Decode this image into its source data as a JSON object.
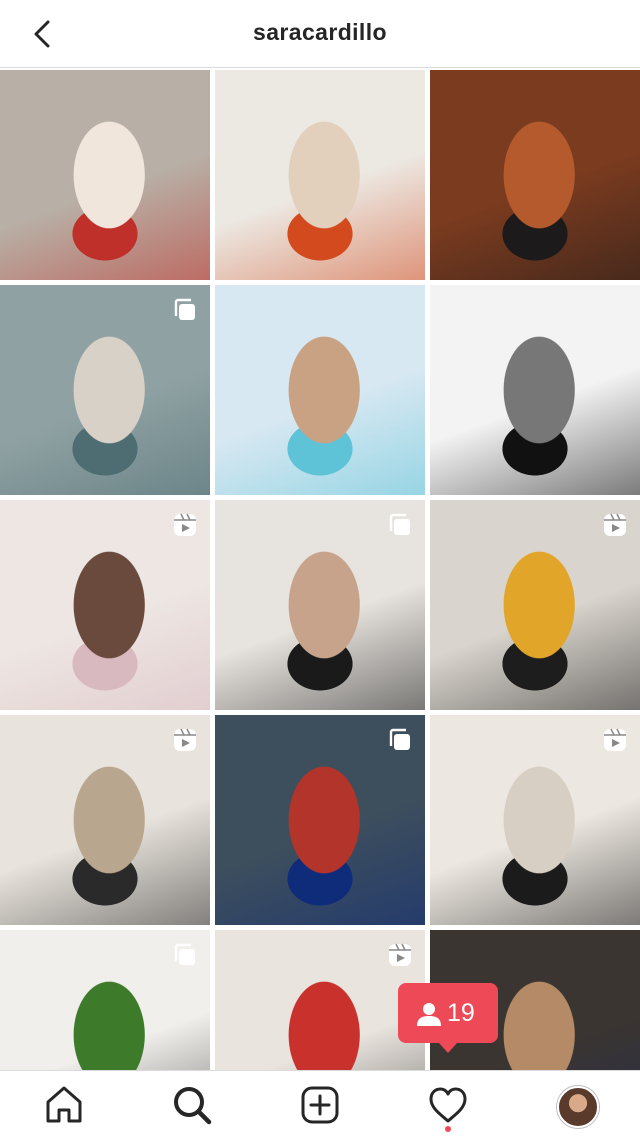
{
  "header": {
    "username": "saracardillo",
    "back_icon": "chevron-left-icon"
  },
  "posts": [
    {
      "id": 1,
      "badge": "none",
      "colors": [
        "#b8b0a6",
        "#c0302a",
        "#f1e6dc"
      ]
    },
    {
      "id": 2,
      "badge": "none",
      "colors": [
        "#ece8e2",
        "#d24a1e",
        "#e2d0bd"
      ]
    },
    {
      "id": 3,
      "badge": "none",
      "colors": [
        "#7a3b1f",
        "#1c1a1a",
        "#b45a2c"
      ]
    },
    {
      "id": 4,
      "badge": "carousel",
      "colors": [
        "#8fa1a3",
        "#4e6d72",
        "#d8d1c7"
      ]
    },
    {
      "id": 5,
      "badge": "none",
      "colors": [
        "#d7e8f2",
        "#5fc3d8",
        "#c9a183"
      ]
    },
    {
      "id": 6,
      "badge": "none",
      "colors": [
        "#f3f3f3",
        "#111111",
        "#777777"
      ]
    },
    {
      "id": 7,
      "badge": "reel",
      "colors": [
        "#ede6e2",
        "#d9b9c0",
        "#6b4a3e"
      ]
    },
    {
      "id": 8,
      "badge": "carousel",
      "colors": [
        "#e7e3de",
        "#1a1a1a",
        "#c8a38c"
      ]
    },
    {
      "id": 9,
      "badge": "reel",
      "colors": [
        "#d9d4cd",
        "#1d1d1d",
        "#e1a52a"
      ]
    },
    {
      "id": 10,
      "badge": "reel",
      "colors": [
        "#e8e3dc",
        "#2a2a2a",
        "#b9a68e"
      ]
    },
    {
      "id": 11,
      "badge": "carousel",
      "colors": [
        "#3d4e5d",
        "#0f2c7a",
        "#b3342a"
      ]
    },
    {
      "id": 12,
      "badge": "reel",
      "colors": [
        "#ece7e0",
        "#1b1b1b",
        "#d8cfc4"
      ]
    },
    {
      "id": 13,
      "badge": "carousel",
      "colors": [
        "#f0efeb",
        "#1b1b1b",
        "#3d7a2a"
      ]
    },
    {
      "id": 14,
      "badge": "reel",
      "colors": [
        "#e9e4de",
        "#191919",
        "#c8312c"
      ]
    },
    {
      "id": 15,
      "badge": "none",
      "colors": [
        "#3a3530",
        "#1e2a66",
        "#b58a66"
      ]
    }
  ],
  "nav": {
    "home_icon": "home-icon",
    "search_icon": "search-icon",
    "add_icon": "add-post-icon",
    "activity_icon": "heart-icon",
    "profile_icon": "profile-avatar"
  },
  "notification": {
    "icon": "person-icon",
    "count": "19",
    "color": "#ed4956"
  }
}
